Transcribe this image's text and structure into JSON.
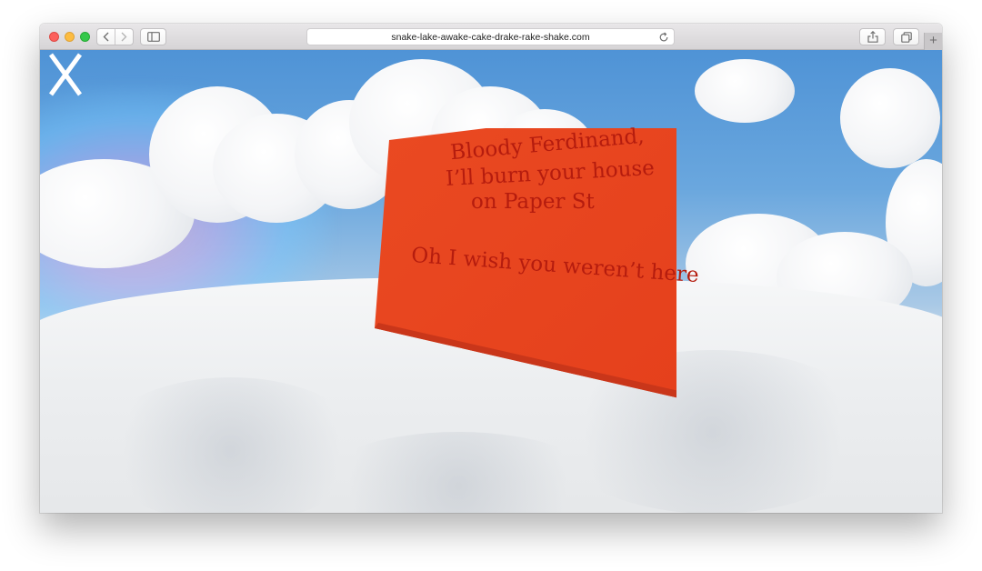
{
  "browser": {
    "url": "snake-lake-awake-cake-drake-rake-shake.com",
    "new_tab_label": "+",
    "buttons": {
      "back": "chevron-left-icon",
      "forward": "chevron-right-icon",
      "sidebar": "sidebar-icon",
      "reload": "reload-icon",
      "share": "share-icon",
      "tabs": "tabs-overview-icon"
    }
  },
  "page": {
    "logo": "X",
    "card": {
      "line1": "Bloody Ferdinand,",
      "line2": "I’ll burn your house",
      "line3": "on Paper St",
      "line4": "Oh I wish you weren’t here"
    }
  },
  "colors": {
    "card_face": "#e8431f",
    "card_side": "#c3300f",
    "card_text": "#b51c0e",
    "sky_top": "#4f93d6",
    "logo": "#ffffff"
  }
}
